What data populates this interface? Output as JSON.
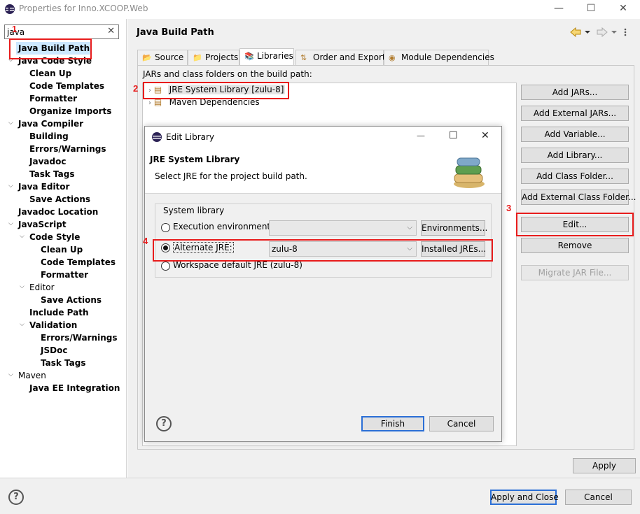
{
  "window": {
    "title": "Properties for Inno.XCOOP.Web",
    "minimize_glyph": "—",
    "maximize_glyph": "☐",
    "close_glyph": "✕"
  },
  "filter": {
    "value": "java",
    "clear_glyph": "✕"
  },
  "tree": [
    {
      "label": "Java Build Path",
      "bold": true
    },
    {
      "label": "Java Code Style",
      "bold": true
    },
    {
      "label": "Clean Up",
      "bold": true
    },
    {
      "label": "Code Templates",
      "bold": true
    },
    {
      "label": "Formatter",
      "bold": true
    },
    {
      "label": "Organize Imports",
      "bold": true
    },
    {
      "label": "Java Compiler",
      "bold": true
    },
    {
      "label": "Building",
      "bold": true
    },
    {
      "label": "Errors/Warnings",
      "bold": true
    },
    {
      "label": "Javadoc",
      "bold": true
    },
    {
      "label": "Task Tags",
      "bold": true
    },
    {
      "label": "Java Editor",
      "bold": true
    },
    {
      "label": "Save Actions",
      "bold": true
    },
    {
      "label": "Javadoc Location",
      "bold": true
    },
    {
      "label": "JavaScript",
      "bold": true
    },
    {
      "label": "Code Style",
      "bold": true
    },
    {
      "label": "Clean Up",
      "bold": true
    },
    {
      "label": "Code Templates",
      "bold": true
    },
    {
      "label": "Formatter",
      "bold": true
    },
    {
      "label": "Editor",
      "bold": false
    },
    {
      "label": "Save Actions",
      "bold": true
    },
    {
      "label": "Include Path",
      "bold": true
    },
    {
      "label": "Validation",
      "bold": true
    },
    {
      "label": "Errors/Warnings",
      "bold": true
    },
    {
      "label": "JSDoc",
      "bold": true
    },
    {
      "label": "Task Tags",
      "bold": true
    },
    {
      "label": "Maven",
      "bold": false
    },
    {
      "label": "Java EE Integration",
      "bold": true
    }
  ],
  "page": {
    "title": "Java Build Path"
  },
  "tabs": [
    {
      "label": "Source"
    },
    {
      "label": "Projects"
    },
    {
      "label": "Libraries"
    },
    {
      "label": "Order and Export"
    },
    {
      "label": "Module Dependencies"
    }
  ],
  "libraries": {
    "caption": "JARs and class folders on the build path:",
    "entries": [
      "JRE System Library [zulu-8]",
      "Maven Dependencies"
    ]
  },
  "side_buttons": {
    "add_jars": "Add JARs...",
    "add_external_jars": "Add External JARs...",
    "add_variable": "Add Variable...",
    "add_library": "Add Library...",
    "add_class_folder": "Add Class Folder...",
    "add_external_class_folder": "Add External Class Folder...",
    "edit": "Edit...",
    "remove": "Remove",
    "migrate_jar": "Migrate JAR File..."
  },
  "apply_label": "Apply",
  "bottom": {
    "apply_and_close": "Apply and Close",
    "cancel": "Cancel",
    "help_glyph": "?"
  },
  "dialog": {
    "title": "Edit Library",
    "header_title": "JRE System Library",
    "header_desc": "Select JRE for the project build path.",
    "group_label": "System library",
    "exec_env_label": "Execution environment:",
    "exec_env_value": "",
    "environments_button": "Environments...",
    "alternate_jre_label": "Alternate JRE:",
    "alternate_jre_value": "zulu-8",
    "installed_jres_button": "Installed JREs...",
    "workspace_default_label": "Workspace default JRE (zulu-8)",
    "finish": "Finish",
    "cancel": "Cancel",
    "help_glyph": "?",
    "selected_option": "alternate_jre"
  },
  "annotations": [
    "1",
    "2",
    "3",
    "4"
  ],
  "colors": {
    "annotation_red": "#e81c1c",
    "selection": "#cce8ff",
    "default_button_border": "#2b6fd6"
  }
}
